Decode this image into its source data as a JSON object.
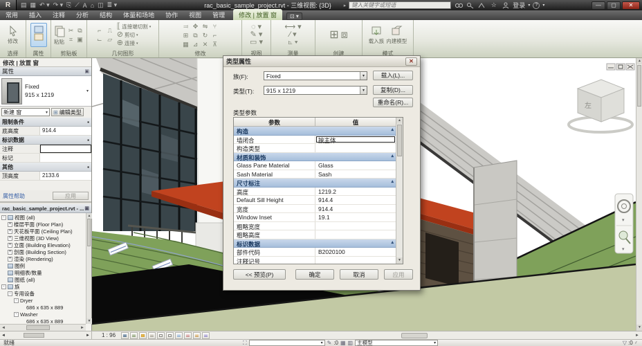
{
  "titlebar": {
    "app_letter": "R",
    "title": "rac_basic_sample_project.rvt - 三维视图: {3D}",
    "search_placeholder": "键入关键字或短语",
    "signin_label": "登录",
    "help_label": "?"
  },
  "tabs": [
    "常用",
    "插入",
    "注释",
    "分析",
    "结构",
    "体量和场地",
    "协作",
    "视图",
    "管理"
  ],
  "active_tab": "修改 | 放置 窗",
  "ribbon": {
    "panels": [
      {
        "label": "选择"
      },
      {
        "label": "属性"
      },
      {
        "label": "剪贴板"
      },
      {
        "label": "几何图形"
      },
      {
        "label": "修改"
      },
      {
        "label": "视图"
      },
      {
        "label": "测量"
      },
      {
        "label": "创建"
      },
      {
        "label": "模式"
      }
    ],
    "modify_tool": "修改",
    "paste_tool": "粘贴",
    "geometry_items": [
      "连接端切割",
      "剪切",
      "连接"
    ],
    "load_family": "载入族",
    "inplace_model": "内建模型"
  },
  "properties_panel": {
    "context_bar": "修改 | 放置 窗",
    "header": "属性",
    "type_name": "Fixed",
    "type_size": "915 x 1219",
    "new_label": "新建 窗",
    "edit_type_label": "编辑类型",
    "groups": [
      {
        "name": "限制条件",
        "rows": [
          {
            "label": "底高度",
            "value": "914.4",
            "editing": false
          }
        ]
      },
      {
        "name": "标识数据",
        "rows": [
          {
            "label": "注释",
            "value": "",
            "editing": true
          },
          {
            "label": "标记",
            "value": "",
            "editing": false
          }
        ]
      },
      {
        "name": "其他",
        "rows": [
          {
            "label": "顶高度",
            "value": "2133.6",
            "editing": false
          }
        ]
      }
    ],
    "help_link": "属性帮助",
    "apply_label": "应用"
  },
  "browser": {
    "title": "rac_basic_sample_project.rvt - ...",
    "items": [
      {
        "label": "视图 (all)",
        "depth": 0,
        "exp": "-",
        "icon": true
      },
      {
        "label": "楼层平面 (Floor Plan)",
        "depth": 1,
        "exp": "+",
        "icon": false
      },
      {
        "label": "天花板平面 (Ceiling Plan)",
        "depth": 1,
        "exp": "+",
        "icon": false
      },
      {
        "label": "三维视图 (3D View)",
        "depth": 1,
        "exp": "+",
        "icon": false
      },
      {
        "label": "立面 (Building Elevation)",
        "depth": 1,
        "exp": "+",
        "icon": false
      },
      {
        "label": "剖面 (Building Section)",
        "depth": 1,
        "exp": "+",
        "icon": false
      },
      {
        "label": "渲染 (Rendering)",
        "depth": 1,
        "exp": "+",
        "icon": false
      },
      {
        "label": "图例",
        "depth": 0,
        "exp": "",
        "icon": true
      },
      {
        "label": "明细表/数量",
        "depth": 0,
        "exp": "",
        "icon": true
      },
      {
        "label": "图纸 (all)",
        "depth": 0,
        "exp": "",
        "icon": true
      },
      {
        "label": "族",
        "depth": 0,
        "exp": "-",
        "icon": true
      },
      {
        "label": "专用设备",
        "depth": 1,
        "exp": "-",
        "icon": false
      },
      {
        "label": "Dryer",
        "depth": 2,
        "exp": "-",
        "icon": false
      },
      {
        "label": "686 x 635 x 889",
        "depth": 3,
        "exp": "",
        "icon": false
      },
      {
        "label": "Washer",
        "depth": 2,
        "exp": "-",
        "icon": false
      },
      {
        "label": "686 x 635 x 889",
        "depth": 3,
        "exp": "",
        "icon": false
      }
    ]
  },
  "dialog": {
    "title": "类型属性",
    "family_label": "族(F):",
    "family_value": "Fixed",
    "type_label": "类型(T):",
    "type_value": "915 x 1219",
    "load_btn": "载入(L)...",
    "duplicate_btn": "复制(D)...",
    "rename_btn": "重命名(R)...",
    "params_label": "类型参数",
    "col_param": "参数",
    "col_value": "值",
    "rows": [
      {
        "kind": "group",
        "label": "构造"
      },
      {
        "kind": "row",
        "label": "墙闭合",
        "value": "按主体",
        "editing": true
      },
      {
        "kind": "row",
        "label": "构造类型",
        "value": "",
        "editing": false
      },
      {
        "kind": "group",
        "label": "材质和装饰"
      },
      {
        "kind": "row",
        "label": "Glass Pane Material",
        "value": "Glass",
        "editing": false
      },
      {
        "kind": "row",
        "label": "Sash Material",
        "value": "Sash",
        "editing": false
      },
      {
        "kind": "group",
        "label": "尺寸标注"
      },
      {
        "kind": "row",
        "label": "高度",
        "value": "1219.2",
        "editing": false
      },
      {
        "kind": "row",
        "label": "Default Sill Height",
        "value": "914.4",
        "editing": false
      },
      {
        "kind": "row",
        "label": "宽度",
        "value": "914.4",
        "editing": false
      },
      {
        "kind": "row",
        "label": "Window Inset",
        "value": "19.1",
        "editing": false
      },
      {
        "kind": "row",
        "label": "粗略宽度",
        "value": "",
        "editing": false
      },
      {
        "kind": "row",
        "label": "粗略高度",
        "value": "",
        "editing": false
      },
      {
        "kind": "group",
        "label": "标识数据"
      },
      {
        "kind": "row",
        "label": "部件代码",
        "value": "B2020100",
        "editing": false
      },
      {
        "kind": "row",
        "label": "注释记号",
        "value": "",
        "editing": false
      }
    ],
    "preview_btn": "<< 预览(P)",
    "ok_btn": "确定",
    "cancel_btn": "取消",
    "apply_btn": "应用"
  },
  "scene": {
    "viewcube_face": "左",
    "colors": {
      "lawn": "#7FA15A",
      "sage": "#C2C9A4",
      "canopy_red": "#C1431F",
      "roof_gray": "#C9C8C3",
      "shadow_black": "#0A0A0A",
      "wood": "#E8DFC0",
      "curtain_wall": "#39454A",
      "brown_wall": "#5E5142"
    }
  },
  "viewbar": {
    "scale": "1 : 96"
  },
  "statusbar": {
    "ready": "就绪",
    "workset_value": "",
    "requests_count": ":0",
    "main_model": "主模型",
    "filter_count": ":0"
  }
}
